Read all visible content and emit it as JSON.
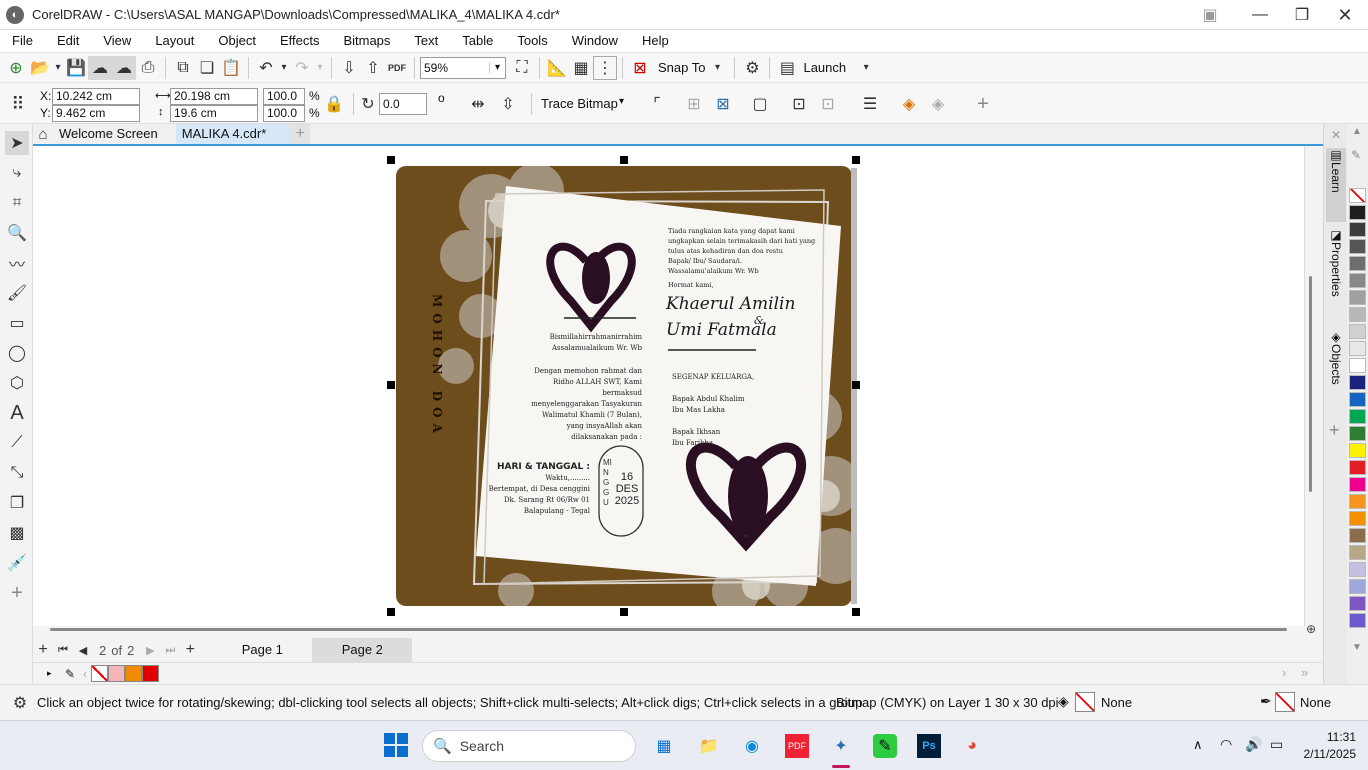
{
  "title_bar": {
    "title": "CorelDRAW - C:\\Users\\ASAL MANGAP\\Downloads\\Compressed\\MALIKA_4\\MALIKA 4.cdr*"
  },
  "menu": [
    "File",
    "Edit",
    "View",
    "Layout",
    "Object",
    "Effects",
    "Bitmaps",
    "Text",
    "Table",
    "Tools",
    "Window",
    "Help"
  ],
  "toolbar": {
    "zoom": "59%",
    "snap_to": "Snap To",
    "launch": "Launch",
    "pdf": "PDF"
  },
  "property_bar": {
    "x_label": "X:",
    "x": "10.242 cm",
    "y_label": "Y:",
    "y": "9.462 cm",
    "width": "20.198 cm",
    "height": "19.6 cm",
    "scale_w": "100.0",
    "scale_h": "100.0",
    "pct": "%",
    "rotation": "0.0",
    "deg": "o",
    "trace_bitmap": "Trace Bitmap"
  },
  "tabs": {
    "welcome": "Welcome Screen",
    "doc": "MALIKA 4.cdr*"
  },
  "dockers": {
    "learn": "Learn",
    "properties": "Properties",
    "objects": "Objects"
  },
  "palette_colors": [
    "#ffffff",
    "#1e1e1e",
    "#3c3c3c",
    "#555555",
    "#6e6e6e",
    "#888888",
    "#9f9f9f",
    "#b8b8b8",
    "#d0d0d0",
    "#e8e8e8",
    "#ffffff",
    "#1a237e",
    "#1565c0",
    "#00a651",
    "#2e7d32",
    "#fff200",
    "#e31e24",
    "#ec008c",
    "#f7941d",
    "#f39200",
    "#8b6e4e",
    "#b8a88a",
    "#c5c0e0",
    "#9fa8da",
    "#7e57c2",
    "#6a5acd"
  ],
  "document": {
    "bg_brown": "#6e4d1c",
    "mohon_doa": "MOHON DOA",
    "left_text": {
      "bismillah": "Bismillahirrahmanirrahim",
      "salam": "Assalamualaikum Wr. Wb",
      "p1": "Dengan memohon rahmat dan",
      "p2": "Ridho ALLAH SWT, Kami bermaksud",
      "p3": "menyelenggarakan Tasyakuran",
      "p4": "Walimatul Khamli (7 Bulan),",
      "p5": "yang insyaAllah akan",
      "p6": "dilaksanakan pada :",
      "hari": "HARI & TANGGAL :",
      "waktu": "Waktu,.........",
      "tempat": "Bertempat, di Desa cenggini",
      "alamat": "Dk. Sarang Rt 06/Rw 01",
      "kota": "Balapulang - Tegal"
    },
    "date_badge": {
      "day": "MINGGU",
      "date": "16",
      "month": "DES",
      "year": "2025"
    },
    "right_text": {
      "r1": "Tiada rangkaian kata yang dapat kami",
      "r2": "ungkapkan selain terimakasih dari hati yang",
      "r3": "tulus atas kehadiran dan doa restu",
      "r4": "Bapak/ Ibu/ Saudara/i.",
      "r5": "Wassalamu'alaikum Wr. Wb",
      "hormat": "Hormat kami,",
      "name1": "Khaerul Amilin",
      "amp": "&",
      "name2": "Umi Fatmala",
      "keluarga": "SEGENAP KELUARGA,",
      "k1": "Bapak Abdul Khalim",
      "k2": "Ibu Mas Lakha",
      "k3": "Bapak Ikhsan",
      "k4": "Ibu Farikha"
    }
  },
  "pagebar": {
    "current": "2",
    "of": "of",
    "total": "2",
    "page1": "Page 1",
    "page2": "Page 2"
  },
  "doc_palette": [
    "#f4b6b6",
    "#f08a00",
    "#e00000"
  ],
  "status": {
    "hint": "Click an object twice for rotating/skewing; dbl-clicking tool selects all objects; Shift+click multi-selects; Alt+click digs; Ctrl+click selects in a group",
    "info": "Bitmap (CMYK) on Layer 1  30 x 30 dpi",
    "fill": "None",
    "outline": "None"
  },
  "taskbar": {
    "search": "Search",
    "time": "11:31",
    "date": "2/11/2025"
  }
}
